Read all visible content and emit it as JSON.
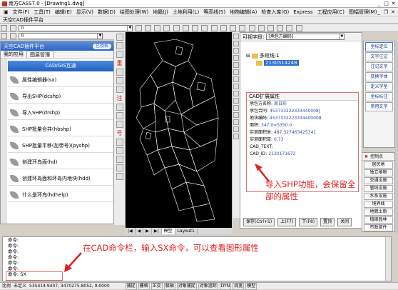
{
  "window": {
    "title": "南方CASS7.0 - [Drawing1.dwg]"
  },
  "menu": [
    "文件(F)",
    "工具(T)",
    "编辑(E)",
    "显示(V)",
    "数据(D)",
    "绘图处理(W)",
    "地籍(J)",
    "土地利用(L)",
    "等高线(S)",
    "地物编辑(A)",
    "检查入库(G)",
    "Express",
    "工程应用(C)",
    "图幅管理(M)"
  ],
  "platform_bar": "天空CAD插件平台",
  "toolbar": {
    "layer_combo": "0",
    "layer_combo2": "0"
  },
  "left_panel": {
    "title": "天空CAD插件平台",
    "badge": "已授权",
    "tabs": [
      "我的应用",
      "图层管理"
    ],
    "category": "CAD/GIS互通",
    "items": [
      "属性编辑器(sx)",
      "导出SHP(dcshp)",
      "导入SHP(drshp)",
      "SHP批量合并(hbshp)",
      "SHP批量平移(加带号)(pyshp)",
      "创建环岛面(hd)",
      "创建环岛面和环岛内地块(hdd)",
      "什么是环岛(hdhelp)"
    ]
  },
  "tool_column": {
    "labels": [
      "重",
      "注",
      "号"
    ]
  },
  "drawing_tabs": [
    "模型",
    "Layout1"
  ],
  "tree_panel": {
    "label": "可视字段:",
    "field_combo": "[承包方编码]",
    "root": "多段线:1",
    "selected": "2130514248",
    "props_title": "CAD扩展属性",
    "props": [
      {
        "k": "承包方名称:",
        "v": "周日彩"
      },
      {
        "k": "承包合同:",
        "v": "453733222333440008J"
      },
      {
        "k": "地块编码:",
        "v": "4537332223334400008"
      },
      {
        "k": "面积:",
        "v": "347.0=5350.0"
      },
      {
        "k": "实测面积米:",
        "v": "487.327463425341"
      },
      {
        "k": "实测面积亩:",
        "v": "0.73"
      },
      {
        "k": "CAD_TEXT:",
        "v": ""
      },
      {
        "k": "CAD_ID:",
        "v": "2130171672"
      }
    ],
    "buttons": [
      "保存(Ctrl+S)",
      "上(F7)",
      "下(F8)",
      "置顶",
      "关闭"
    ]
  },
  "annotations": {
    "shp": "导入SHP功能，会保留全部的属性",
    "cmd": "在CAD命令栏，输入SX命令，可以查看图形属性"
  },
  "right_panel1": [
    "坐标定位",
    "文字注记",
    "注记文字",
    "变换字体",
    "定义字型",
    "坐标标注",
    "常用文字"
  ],
  "right_panel2": {
    "header": "控制点",
    "items": [
      "居民地",
      "独立地物",
      "交通设施",
      "管线设施",
      "水系设施",
      "境界线",
      "地貌土质",
      "植被园林",
      "市政部件"
    ]
  },
  "command": {
    "lines": [
      "命令:",
      "命令:",
      "命令:",
      "命令:",
      "命令:",
      "命令:"
    ],
    "prompt": "命令: SX"
  },
  "status": {
    "scale": "比例",
    "mode": "未定义",
    "coords": "535414.9407, 3470275.8052, 0.0000",
    "toggles": [
      "捕捉",
      "栅格",
      "正交",
      "极轴",
      "对象捕捉",
      "对象追踪",
      "DYN",
      "线宽",
      "模型"
    ]
  }
}
